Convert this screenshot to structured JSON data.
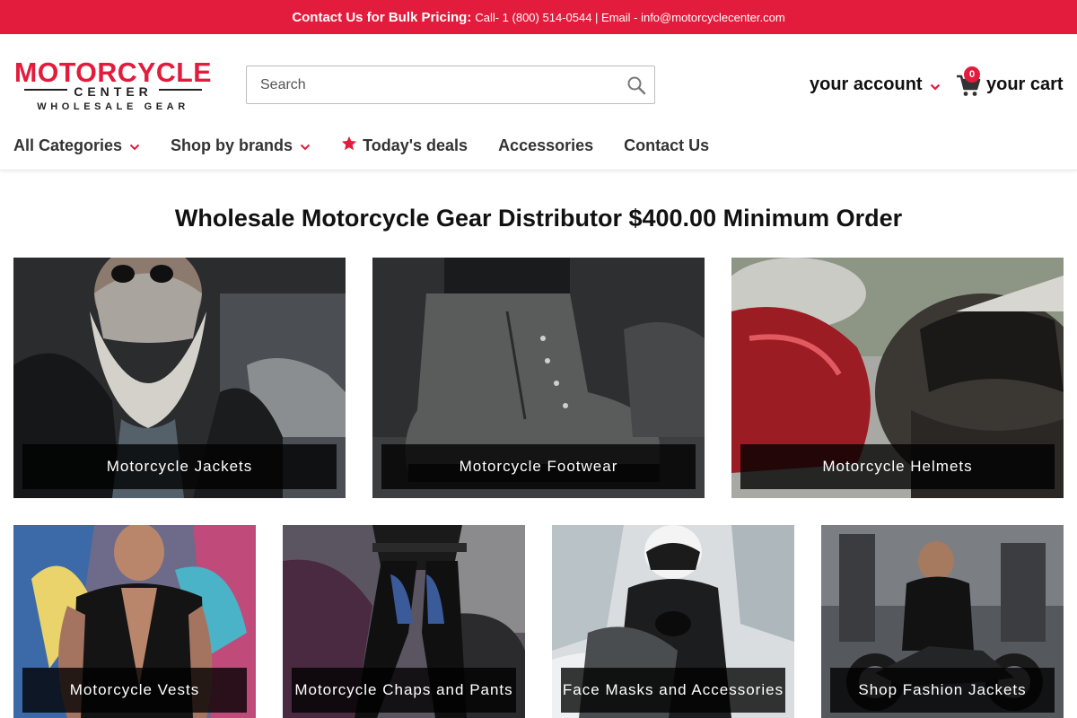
{
  "topbar": {
    "strong": "Contact Us for Bulk Pricing:",
    "details": "Call- 1 (800) 514-0544 | Email - info@motorcyclecenter.com"
  },
  "header": {
    "logo": {
      "line1": "MOTORCYCLE",
      "line2": "CENTER",
      "line3": "WHOLESALE GEAR"
    },
    "search": {
      "placeholder": "Search",
      "value": ""
    },
    "account_label": "your account",
    "cart": {
      "label": "your cart",
      "count": "0"
    },
    "nav": [
      {
        "label": "All Categories",
        "icon": "chevron-down-icon"
      },
      {
        "label": "Shop by brands",
        "icon": "chevron-down-icon"
      },
      {
        "label": "Today's deals",
        "icon": "star-icon"
      },
      {
        "label": "Accessories"
      },
      {
        "label": "Contact Us"
      }
    ]
  },
  "main": {
    "heading": "Wholesale Motorcycle Gear Distributor $400.00 Minimum Order",
    "categories": [
      {
        "label": "Motorcycle Jackets"
      },
      {
        "label": "Motorcycle Footwear"
      },
      {
        "label": "Motorcycle Helmets"
      },
      {
        "label": "Motorcycle Vests"
      },
      {
        "label": "Motorcycle Chaps and Pants"
      },
      {
        "label": "Face Masks and Accessories"
      },
      {
        "label": "Shop Fashion Jackets"
      }
    ]
  },
  "colors": {
    "accent": "#e31b3c",
    "caption_bg": "#000000",
    "text": "#111111"
  }
}
